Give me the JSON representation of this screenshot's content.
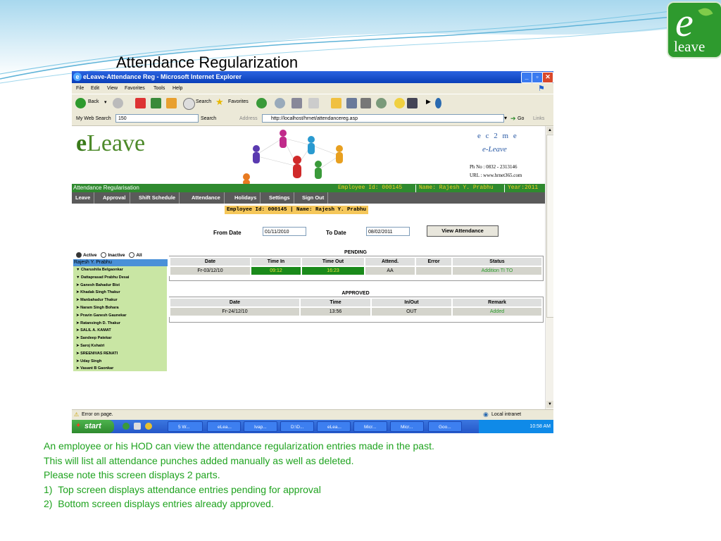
{
  "slide": {
    "title": "Attendance Regularization",
    "logo": {
      "letter": "e",
      "word": "leave"
    },
    "description": [
      "An employee  or his HOD can view the attendance regularization entries made in the past.",
      "This will list all attendance punches added manually as well as deleted.",
      "Please note this screen displays 2 parts.",
      "1)  Top screen displays attendance entries pending for approval",
      "2)  Bottom screen displays entries already approved."
    ]
  },
  "browser": {
    "title": "eLeave-Attendance Reg - Microsoft Internet Explorer",
    "menu": [
      "File",
      "Edit",
      "View",
      "Favorites",
      "Tools",
      "Help"
    ],
    "toolbar": {
      "back": "Back",
      "search": "Search",
      "favorites": "Favorites"
    },
    "address_row": {
      "my_web_search_label": "My Web Search",
      "web_search_value": "150",
      "search_button": "Search",
      "address_label": "Address",
      "url": "http://localhost/hrnet/attendancereg.asp",
      "go_label": "Go",
      "links_label": "Links"
    },
    "status": {
      "left": "Error on page.",
      "right": "Local intranet"
    }
  },
  "app": {
    "logo_text": "Leave",
    "logo_e": "e",
    "brand_top": "e c 2 m e",
    "brand_sub": "e-Leave",
    "phone": "Ph No : 0832 - 2313146",
    "url": "URL : www.hrnet365.com",
    "header_bar": {
      "title": "Attendance Regularisation",
      "employee_id": "Employee Id: 000145",
      "name": "Name: Rajesh Y. Prabhu",
      "year": "Year:2011"
    },
    "nav": [
      "Leave",
      "Approval",
      "Shift Schedule",
      "Attendance",
      "Holidays",
      "Settings",
      "Sign Out"
    ],
    "employee_badge": "Employee Id: 000145 | Name: Rajesh Y. Prabhu",
    "filter": {
      "from_label": "From Date",
      "from_value": "01/11/2010",
      "to_label": "To Date",
      "to_value": "08/02/2011",
      "view_button": "View Attendance"
    },
    "radio": {
      "active": "Active",
      "inactive": "Inactive",
      "all": "All",
      "selected": "Active"
    },
    "employee_panel": {
      "head": "Rajesh Y. Prabhu",
      "items": [
        "▼ Charushila Belgaonkar",
        "▼ Dattaprasad Prabhu Desai",
        "➤ Ganesh Bahadur Bist",
        "➤ Khadak Singh Thakur",
        "➤ Manbahadur Thakur",
        "➤ Naram Singh Bohara",
        "➤ Pravin Ganesh Gaunekar",
        "➤ Ratansingh D. Thakur",
        "➤ SALIL A. KAMAT",
        "➤ Sandeep Patekar",
        "➤ Saroj Kshatri",
        "➤ SREENIVAS RENATI",
        "➤ Uday Singh",
        "➤ Vasant B Gaonkar"
      ]
    },
    "pending": {
      "title": "PENDING",
      "headers": [
        "Date",
        "Time In",
        "Time Out",
        "Attend.",
        "Error",
        "Status"
      ],
      "rows": [
        {
          "date": "Fr-03/12/10",
          "time_in": "09:12",
          "time_out": "16:23",
          "attend": "AA",
          "error": "",
          "status": "Addition TI TO"
        }
      ],
      "highlight_color": "#1a8a1a",
      "status_color": "#2a9a2a"
    },
    "approved": {
      "title": "APPROVED",
      "headers": [
        "Date",
        "Time",
        "In/Out",
        "Remark"
      ],
      "rows": [
        {
          "date": "Fr-24/12/10",
          "time": "13:56",
          "inout": "OUT",
          "remark": "Added"
        }
      ]
    }
  },
  "taskbar": {
    "start": "start",
    "tasks": [
      "5 W...",
      "eLea...",
      "Ivap...",
      "D:\\D...",
      "eLea...",
      "Micr...",
      "Micr...",
      "Goo..."
    ],
    "clock": "10:58 AM"
  },
  "colors": {
    "green_bar": "#2f8a2f",
    "nav_bar": "#5a5a5a",
    "badge": "#f5c75a",
    "panel": "#c9e6a4",
    "slide_text": "#1fa31f"
  }
}
